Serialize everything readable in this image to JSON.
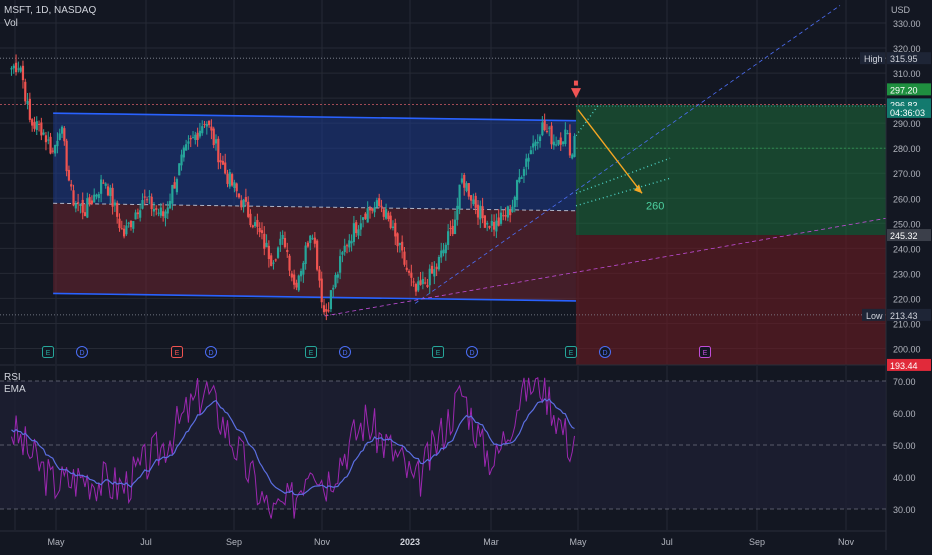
{
  "header": {
    "symbol": "MSFT, 1D, NASDAQ",
    "volume_label": "Vol"
  },
  "price_axis": {
    "currency": "USD",
    "ticks": [
      330,
      320,
      310,
      290,
      280,
      270,
      260,
      250,
      240,
      230,
      220,
      210,
      200
    ],
    "high_label": "High",
    "high_value": "315.95",
    "low_label": "Low",
    "low_value": "213.43",
    "target_top": "297.20",
    "last_price": "296.83",
    "countdown": "04:36:03",
    "stop_level": "245.32",
    "bottom_level": "193.44"
  },
  "rsi_pane": {
    "title": "RSI",
    "ema_label": "EMA",
    "ticks": [
      "70.00",
      "60.00",
      "50.00",
      "40.00",
      "30.00"
    ]
  },
  "time_axis": {
    "labels": [
      "May",
      "Jul",
      "Sep",
      "Nov",
      "2023",
      "Mar",
      "May",
      "Jul",
      "Sep",
      "Nov"
    ]
  },
  "events": [
    {
      "type": "E"
    },
    {
      "type": "D"
    },
    {
      "type": "E"
    },
    {
      "type": "D"
    },
    {
      "type": "E"
    },
    {
      "type": "D"
    },
    {
      "type": "E"
    },
    {
      "type": "D"
    },
    {
      "type": "E"
    },
    {
      "type": "D"
    },
    {
      "type": "E"
    }
  ],
  "annotation": {
    "target_text": "260"
  },
  "colors": {
    "background": "#131722",
    "up": "#26a69a",
    "down": "#ef5350",
    "channel_top": "#1e3a8a",
    "channel_bottom": "#6d2430",
    "trend_line": "#2962ff",
    "rsi": "#9c27b0",
    "ema": "#5b6ee1",
    "arrow": "#f5a623",
    "target_dots": "#4dd0c4"
  },
  "chart_data": {
    "type": "candlestick",
    "title": "MSFT, 1D, NASDAQ",
    "y_range": [
      193,
      333
    ],
    "y_ticks": [
      330,
      320,
      310,
      290,
      280,
      270,
      260,
      250,
      240,
      230,
      220,
      210,
      200
    ],
    "x_ticks": [
      "May",
      "Jul",
      "Sep",
      "Nov",
      "2023",
      "Mar",
      "May",
      "Jul",
      "Sep",
      "Nov"
    ],
    "price_path": [
      {
        "date": "2022-03-30",
        "close": 312
      },
      {
        "date": "2022-04-05",
        "close": 314
      },
      {
        "date": "2022-04-12",
        "close": 290
      },
      {
        "date": "2022-04-20",
        "close": 288
      },
      {
        "date": "2022-04-28",
        "close": 278
      },
      {
        "date": "2022-05-03",
        "close": 290
      },
      {
        "date": "2022-05-11",
        "close": 260
      },
      {
        "date": "2022-05-20",
        "close": 255
      },
      {
        "date": "2022-06-03",
        "close": 268
      },
      {
        "date": "2022-06-16",
        "close": 245
      },
      {
        "date": "2022-06-29",
        "close": 260
      },
      {
        "date": "2022-07-14",
        "close": 253
      },
      {
        "date": "2022-07-27",
        "close": 276
      },
      {
        "date": "2022-08-12",
        "close": 292
      },
      {
        "date": "2022-08-26",
        "close": 270
      },
      {
        "date": "2022-09-13",
        "close": 252
      },
      {
        "date": "2022-09-27",
        "close": 236
      },
      {
        "date": "2022-10-06",
        "close": 244
      },
      {
        "date": "2022-10-13",
        "close": 225
      },
      {
        "date": "2022-10-20",
        "close": 237
      },
      {
        "date": "2022-10-25",
        "close": 250
      },
      {
        "date": "2022-11-03",
        "close": 213
      },
      {
        "date": "2022-11-18",
        "close": 242
      },
      {
        "date": "2022-12-01",
        "close": 255
      },
      {
        "date": "2022-12-13",
        "close": 257
      },
      {
        "date": "2022-12-28",
        "close": 235
      },
      {
        "date": "2023-01-05",
        "close": 222
      },
      {
        "date": "2023-01-19",
        "close": 231
      },
      {
        "date": "2023-02-01",
        "close": 250
      },
      {
        "date": "2023-02-07",
        "close": 268
      },
      {
        "date": "2023-02-21",
        "close": 252
      },
      {
        "date": "2023-03-02",
        "close": 249
      },
      {
        "date": "2023-03-13",
        "close": 256
      },
      {
        "date": "2023-03-21",
        "close": 273
      },
      {
        "date": "2023-04-03",
        "close": 289
      },
      {
        "date": "2023-04-12",
        "close": 283
      },
      {
        "date": "2023-04-20",
        "close": 286
      },
      {
        "date": "2023-04-25",
        "close": 276
      },
      {
        "date": "2023-04-27",
        "close": 296.83
      }
    ],
    "rsi_path": [
      {
        "date": "2022-03-30",
        "rsi": 55
      },
      {
        "date": "2022-04-28",
        "rsi": 38
      },
      {
        "date": "2022-05-20",
        "rsi": 40
      },
      {
        "date": "2022-06-16",
        "rsi": 37
      },
      {
        "date": "2022-07-14",
        "rsi": 50
      },
      {
        "date": "2022-08-12",
        "rsi": 68
      },
      {
        "date": "2022-09-13",
        "rsi": 40
      },
      {
        "date": "2022-09-27",
        "rsi": 28
      },
      {
        "date": "2022-10-13",
        "rsi": 33
      },
      {
        "date": "2022-10-25",
        "rsi": 47
      },
      {
        "date": "2022-11-03",
        "rsi": 38
      },
      {
        "date": "2022-12-01",
        "rsi": 58
      },
      {
        "date": "2022-12-28",
        "rsi": 44
      },
      {
        "date": "2023-01-05",
        "rsi": 37
      },
      {
        "date": "2023-02-07",
        "rsi": 67
      },
      {
        "date": "2023-02-21",
        "rsi": 49
      },
      {
        "date": "2023-03-02",
        "rsi": 45
      },
      {
        "date": "2023-03-21",
        "rsi": 68
      },
      {
        "date": "2023-04-03",
        "rsi": 70
      },
      {
        "date": "2023-04-25",
        "rsi": 48
      },
      {
        "date": "2023-04-27",
        "rsi": 62
      }
    ],
    "rsi_range": [
      25,
      75
    ],
    "channel": {
      "upper": [
        {
          "date": "2022-04-28",
          "price": 294
        },
        {
          "date": "2023-04-27",
          "price": 291
        }
      ],
      "mid": [
        {
          "date": "2022-04-28",
          "price": 258
        },
        {
          "date": "2023-04-27",
          "price": 255
        }
      ],
      "lower": [
        {
          "date": "2022-04-28",
          "price": 222
        },
        {
          "date": "2023-04-27",
          "price": 219
        }
      ]
    },
    "projection": {
      "from": {
        "date": "2023-04-27",
        "price": 297
      },
      "to": {
        "date": "2023-06-12",
        "price": 262
      },
      "target": 260
    },
    "zones": {
      "take_profit_top": 297.2,
      "stop_level": 245.32,
      "bottom": 193.44
    }
  }
}
